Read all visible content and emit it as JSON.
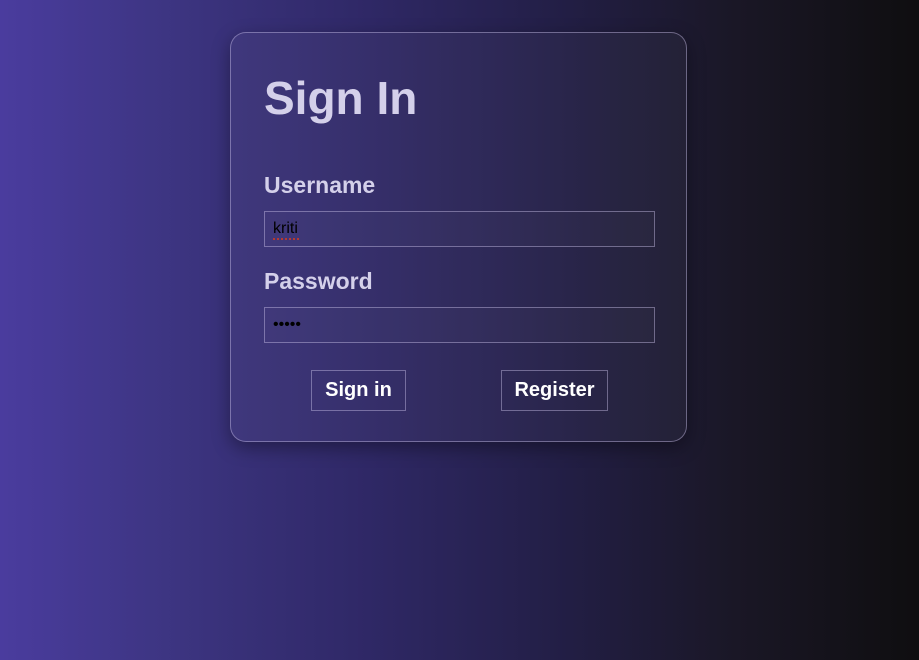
{
  "form": {
    "title": "Sign In",
    "username_label": "Username",
    "username_value": "kriti",
    "password_label": "Password",
    "password_value": "kriti",
    "signin_label": "Sign in",
    "register_label": "Register"
  },
  "colors": {
    "gradient_start": "#4a3c9e",
    "gradient_end": "#0f0e10",
    "heading_text": "#d4d0ea",
    "button_text": "#ffffff"
  }
}
